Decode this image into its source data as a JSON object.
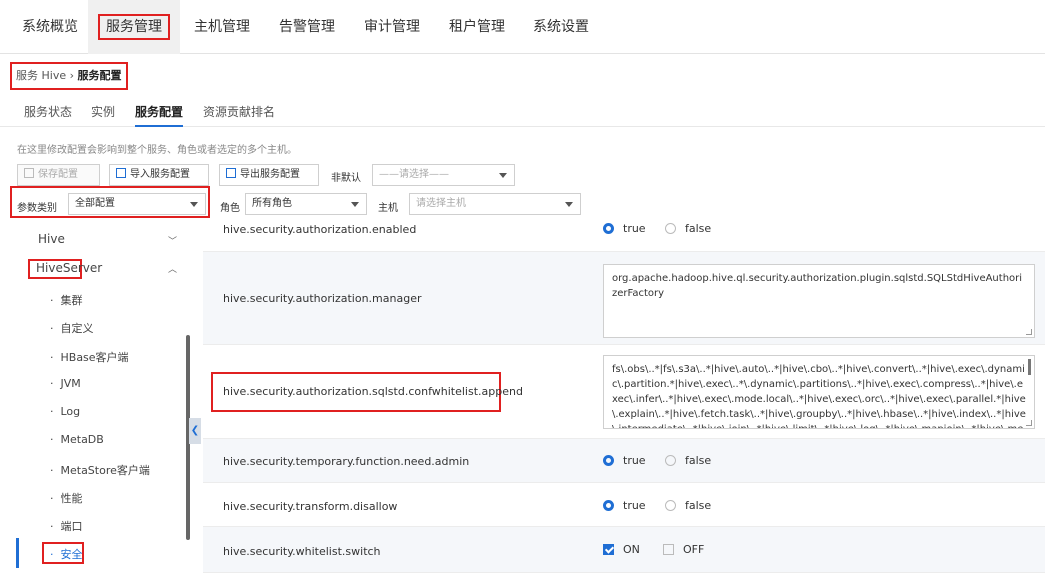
{
  "topnav": {
    "items": [
      "系统概览",
      "服务管理",
      "主机管理",
      "告警管理",
      "审计管理",
      "租户管理",
      "系统设置"
    ],
    "active_index": 1
  },
  "breadcrumb": {
    "service": "服务 Hive",
    "separator": "›",
    "current": "服务配置"
  },
  "subtabs": [
    "服务状态",
    "实例",
    "服务配置",
    "资源贡献排名"
  ],
  "hint": "在这里修改配置会影响到整个服务、角色或者选定的多个主机。",
  "toolbar": {
    "save": "保存配置",
    "import": "导入服务配置",
    "export": "导出服务配置",
    "non_default_label": "非默认",
    "non_default_select": "——请选择——"
  },
  "filters": {
    "category_label": "参数类别",
    "category_value": "全部配置",
    "role_label": "角色",
    "role_value": "所有角色",
    "host_label": "主机",
    "host_placeholder": "请选择主机"
  },
  "tree": {
    "hive": "Hive",
    "hiveserver": "HiveServer",
    "children": [
      "集群",
      "自定义",
      "HBase客户端",
      "JVM",
      "Log",
      "MetaDB",
      "MetaStore客户端",
      "性能",
      "端口",
      "安全"
    ],
    "bullet": "·"
  },
  "params": [
    {
      "name": "hive.security.authorization.enabled",
      "type": "radio",
      "options": [
        "true",
        "false"
      ],
      "selected": "true"
    },
    {
      "name": "hive.security.authorization.manager",
      "type": "text",
      "value": "org.apache.hadoop.hive.ql.security.authorization.plugin.sqlstd.SQLStdHiveAuthorizerFactory"
    },
    {
      "name": "hive.security.authorization.sqlstd.confwhitelist.append",
      "type": "text",
      "value": "fs\\.obs\\..*|fs\\.s3a\\..*|hive\\.auto\\..*|hive\\.cbo\\..*|hive\\.convert\\..*|hive\\.exec\\.dynamic\\.partition.*|hive\\.exec\\..*\\.dynamic\\.partitions\\..*|hive\\.exec\\.compress\\..*|hive\\.exec\\.infer\\..*|hive\\.exec\\.mode.local\\..*|hive\\.exec\\.orc\\..*|hive\\.exec\\.parallel.*|hive\\.explain\\..*|hive\\.fetch.task\\..*|hive\\.groupby\\..*|hive\\.hbase\\..*|hive\\.index\\..*|hive\\.intermediate\\..*|hive\\.join\\..*|hive\\.limit\\..*|hive\\.log\\..*|hive\\.mapjoin\\..*|hive\\.merge\\..*|hive\\.optimize\\..*"
    },
    {
      "name": "hive.security.temporary.function.need.admin",
      "type": "radio",
      "options": [
        "true",
        "false"
      ],
      "selected": "true"
    },
    {
      "name": "hive.security.transform.disallow",
      "type": "radio",
      "options": [
        "true",
        "false"
      ],
      "selected": "true"
    },
    {
      "name": "hive.security.whitelist.switch",
      "type": "checkbox",
      "options": [
        "ON",
        "OFF"
      ],
      "selected": "ON"
    }
  ],
  "colors": {
    "accent": "#1f6ed4",
    "highlight": "#e02020"
  },
  "icons": {
    "collapse": "chevron-left-icon"
  }
}
